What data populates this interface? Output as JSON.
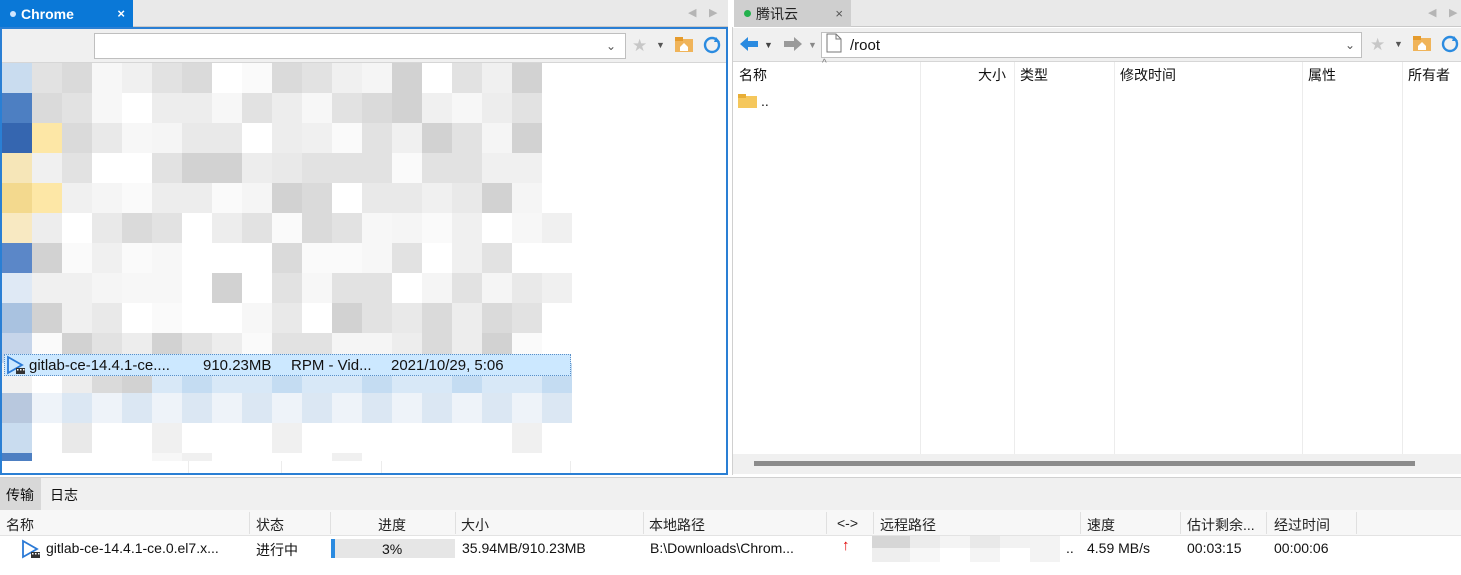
{
  "left_panel": {
    "tab_label": "Chrome",
    "selected_file": {
      "name": "gitlab-ce-14.4.1-ce....",
      "size": "910.23MB",
      "type": "RPM - Vid...",
      "modified": "2021/10/29, 5:06"
    }
  },
  "right_panel": {
    "tab_label": "腾讯云",
    "path": "/root",
    "columns": [
      "名称",
      "大小",
      "类型",
      "修改时间",
      "属性",
      "所有者"
    ],
    "items": [
      {
        "name": ".."
      }
    ]
  },
  "bottom": {
    "tabs": [
      "传输",
      "日志"
    ],
    "columns": [
      "名称",
      "状态",
      "进度",
      "大小",
      "本地路径",
      "<->",
      "远程路径",
      "速度",
      "估计剩余...",
      "经过时间"
    ],
    "transfer": {
      "name": "gitlab-ce-14.4.1-ce.0.el7.x...",
      "status": "进行中",
      "progress": "3%",
      "progress_fraction": 0.03,
      "size": "35.94MB/910.23MB",
      "local_path": "B:\\Downloads\\Chrom...",
      "direction": "↑",
      "remote_path_tail": "..",
      "speed": "4.59 MB/s",
      "remaining": "00:03:15",
      "elapsed": "00:00:06"
    }
  },
  "colors": {
    "active_tab": "#0a78d7",
    "connected_dot": "#22b14c",
    "upload_arrow": "#e00000",
    "selection": "#cce8ff"
  }
}
